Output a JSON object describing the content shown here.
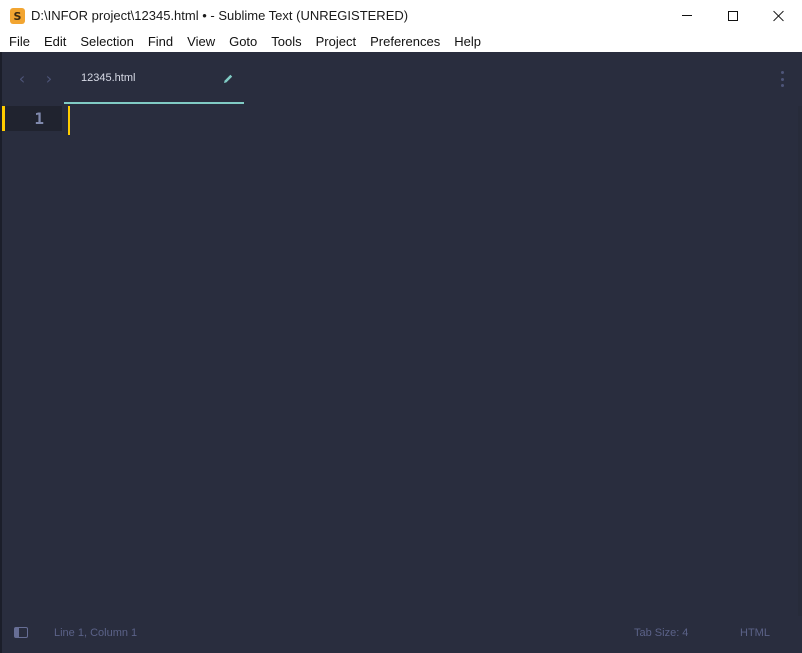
{
  "window": {
    "title": "D:\\INFOR project\\12345.html • - Sublime Text (UNREGISTERED)",
    "logo_icon": "sublime-text-logo-icon"
  },
  "menu": [
    "File",
    "Edit",
    "Selection",
    "Find",
    "View",
    "Goto",
    "Tools",
    "Project",
    "Preferences",
    "Help"
  ],
  "tabs": [
    {
      "label": "12345.html",
      "dirty": true
    }
  ],
  "editor": {
    "line_numbers": [
      "1"
    ],
    "current_line": 1
  },
  "status": {
    "position": "Line 1, Column 1",
    "tab_size": "Tab Size: 4",
    "syntax": "HTML"
  },
  "colors": {
    "background": "#292d3e",
    "accent": "#80cbc4",
    "caret": "#ffcc00"
  }
}
